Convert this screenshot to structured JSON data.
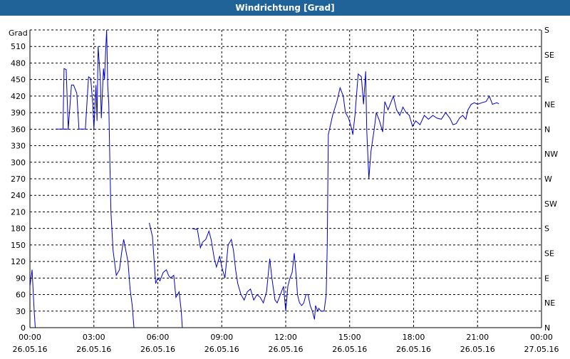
{
  "window": {
    "title": "Windrichtung [Grad]"
  },
  "colors": {
    "titlebar": "#1f6399",
    "series": "#0000cc",
    "grid": "#000000",
    "background": "#ffffff"
  },
  "chart_data": {
    "type": "line",
    "title": "Windrichtung [Grad]",
    "ylabel": "Grad",
    "ylim": [
      0,
      540
    ],
    "xlim": [
      "26.05.16 00:00",
      "27.05.16 00:00"
    ],
    "grid": true,
    "y_ticks": [
      0,
      30,
      60,
      90,
      120,
      150,
      180,
      210,
      240,
      270,
      300,
      330,
      360,
      390,
      420,
      450,
      480,
      510
    ],
    "y2_ticks": [
      {
        "value": 0,
        "label": "N"
      },
      {
        "value": 45,
        "label": "NE"
      },
      {
        "value": 90,
        "label": "E"
      },
      {
        "value": 135,
        "label": "SE"
      },
      {
        "value": 180,
        "label": "S"
      },
      {
        "value": 225,
        "label": "SW"
      },
      {
        "value": 270,
        "label": "W"
      },
      {
        "value": 315,
        "label": "NW"
      },
      {
        "value": 360,
        "label": "N"
      },
      {
        "value": 405,
        "label": "NE"
      },
      {
        "value": 450,
        "label": "E"
      },
      {
        "value": 495,
        "label": "SE"
      },
      {
        "value": 540,
        "label": "S"
      }
    ],
    "x_ticks": [
      {
        "hour": 0,
        "time": "00:00",
        "date": "26.05.16"
      },
      {
        "hour": 3,
        "time": "03:00",
        "date": "26.05.16"
      },
      {
        "hour": 6,
        "time": "06:00",
        "date": "26.05.16"
      },
      {
        "hour": 9,
        "time": "09:00",
        "date": "26.05.16"
      },
      {
        "hour": 12,
        "time": "12:00",
        "date": "26.05.16"
      },
      {
        "hour": 15,
        "time": "15:00",
        "date": "26.05.16"
      },
      {
        "hour": 18,
        "time": "18:00",
        "date": "26.05.16"
      },
      {
        "hour": 21,
        "time": "21:00",
        "date": "26.05.16"
      },
      {
        "hour": 24,
        "time": "00:00",
        "date": "27.05.16"
      }
    ],
    "series": [
      {
        "segments": [
          [
            [
              0.0,
              75
            ],
            [
              0.1,
              105
            ],
            [
              0.2,
              30
            ],
            [
              0.25,
              0
            ]
          ],
          [
            [
              1.2,
              360
            ],
            [
              1.7,
              360
            ],
            [
              1.8,
              360
            ],
            [
              1.55,
              360
            ],
            [
              1.6,
              470
            ],
            [
              1.7,
              468
            ],
            [
              1.8,
              360
            ],
            [
              1.95,
              440
            ],
            [
              2.05,
              440
            ],
            [
              2.2,
              425
            ],
            [
              2.3,
              360
            ],
            [
              2.5,
              360
            ],
            [
              2.6,
              360
            ],
            [
              2.75,
              455
            ],
            [
              2.85,
              452
            ],
            [
              2.95,
              405
            ],
            [
              3.0,
              360
            ],
            [
              3.1,
              440
            ],
            [
              3.15,
              375
            ],
            [
              3.2,
              510
            ],
            [
              3.3,
              455
            ],
            [
              3.35,
              380
            ],
            [
              3.45,
              470
            ],
            [
              3.5,
              450
            ],
            [
              3.55,
              500
            ],
            [
              3.6,
              550
            ],
            [
              3.65,
              440
            ],
            [
              3.7,
              405
            ],
            [
              3.75,
              300
            ],
            [
              3.8,
              210
            ],
            [
              3.9,
              140
            ],
            [
              4.0,
              110
            ],
            [
              4.05,
              95
            ],
            [
              4.2,
              105
            ],
            [
              4.3,
              135
            ],
            [
              4.4,
              160
            ],
            [
              4.5,
              140
            ],
            [
              4.6,
              120
            ],
            [
              4.7,
              70
            ],
            [
              4.8,
              40
            ],
            [
              4.88,
              0
            ]
          ],
          [
            [
              5.6,
              190
            ],
            [
              5.75,
              165
            ],
            [
              5.9,
              80
            ],
            [
              6.0,
              90
            ],
            [
              6.1,
              85
            ],
            [
              6.25,
              100
            ],
            [
              6.4,
              105
            ],
            [
              6.5,
              95
            ],
            [
              6.6,
              90
            ],
            [
              6.75,
              95
            ],
            [
              6.85,
              55
            ],
            [
              7.0,
              65
            ],
            [
              7.1,
              30
            ],
            [
              7.15,
              0
            ]
          ],
          [
            [
              7.6,
              180
            ],
            [
              7.8,
              178
            ],
            [
              7.85,
              180
            ],
            [
              8.0,
              145
            ],
            [
              8.1,
              155
            ],
            [
              8.25,
              160
            ],
            [
              8.4,
              175
            ],
            [
              8.5,
              160
            ],
            [
              8.65,
              125
            ],
            [
              8.75,
              110
            ],
            [
              8.9,
              130
            ],
            [
              9.0,
              110
            ],
            [
              9.15,
              90
            ],
            [
              9.3,
              150
            ],
            [
              9.45,
              160
            ],
            [
              9.55,
              140
            ],
            [
              9.65,
              105
            ],
            [
              9.75,
              80
            ],
            [
              9.9,
              60
            ],
            [
              10.05,
              50
            ],
            [
              10.2,
              65
            ],
            [
              10.35,
              70
            ],
            [
              10.5,
              50
            ],
            [
              10.65,
              60
            ],
            [
              10.8,
              55
            ],
            [
              10.95,
              45
            ],
            [
              11.1,
              65
            ],
            [
              11.25,
              125
            ],
            [
              11.35,
              90
            ],
            [
              11.5,
              50
            ],
            [
              11.6,
              45
            ],
            [
              11.75,
              60
            ],
            [
              11.9,
              75
            ],
            [
              12.0,
              30
            ],
            [
              12.1,
              75
            ],
            [
              12.2,
              90
            ],
            [
              12.3,
              100
            ],
            [
              12.4,
              135
            ],
            [
              12.5,
              90
            ],
            [
              12.55,
              60
            ],
            [
              12.65,
              45
            ],
            [
              12.75,
              40
            ],
            [
              12.85,
              45
            ],
            [
              12.95,
              60
            ],
            [
              13.05,
              60
            ],
            [
              13.15,
              40
            ],
            [
              13.25,
              30
            ],
            [
              13.35,
              15
            ],
            [
              13.4,
              40
            ],
            [
              13.5,
              30
            ],
            [
              13.55,
              35
            ],
            [
              13.65,
              30
            ],
            [
              13.8,
              30
            ],
            [
              13.9,
              60
            ],
            [
              13.95,
              150
            ],
            [
              14.0,
              350
            ],
            [
              14.2,
              385
            ],
            [
              14.4,
              410
            ],
            [
              14.55,
              435
            ],
            [
              14.7,
              420
            ],
            [
              14.8,
              390
            ],
            [
              14.95,
              380
            ],
            [
              15.1,
              360
            ],
            [
              15.15,
              350
            ],
            [
              15.25,
              385
            ],
            [
              15.4,
              460
            ],
            [
              15.55,
              455
            ],
            [
              15.65,
              405
            ],
            [
              15.75,
              465
            ],
            [
              15.8,
              360
            ],
            [
              15.9,
              270
            ],
            [
              16.0,
              320
            ],
            [
              16.15,
              360
            ],
            [
              16.25,
              390
            ],
            [
              16.4,
              375
            ],
            [
              16.55,
              355
            ],
            [
              16.65,
              410
            ],
            [
              16.8,
              395
            ],
            [
              16.95,
              410
            ],
            [
              17.05,
              420
            ],
            [
              17.2,
              395
            ],
            [
              17.35,
              385
            ],
            [
              17.5,
              400
            ],
            [
              17.65,
              390
            ],
            [
              17.8,
              385
            ],
            [
              17.95,
              365
            ],
            [
              18.1,
              375
            ],
            [
              18.3,
              368
            ],
            [
              18.5,
              385
            ],
            [
              18.7,
              378
            ],
            [
              18.9,
              385
            ],
            [
              19.1,
              380
            ],
            [
              19.3,
              378
            ],
            [
              19.5,
              390
            ],
            [
              19.7,
              380
            ],
            [
              19.85,
              368
            ],
            [
              20.0,
              370
            ],
            [
              20.15,
              380
            ],
            [
              20.3,
              385
            ],
            [
              20.45,
              378
            ],
            [
              20.55,
              395
            ],
            [
              20.7,
              405
            ],
            [
              20.85,
              408
            ],
            [
              21.0,
              405
            ],
            [
              21.2,
              408
            ],
            [
              21.4,
              410
            ],
            [
              21.55,
              420
            ],
            [
              21.7,
              405
            ],
            [
              21.9,
              408
            ],
            [
              22.0,
              406
            ]
          ]
        ]
      }
    ]
  }
}
